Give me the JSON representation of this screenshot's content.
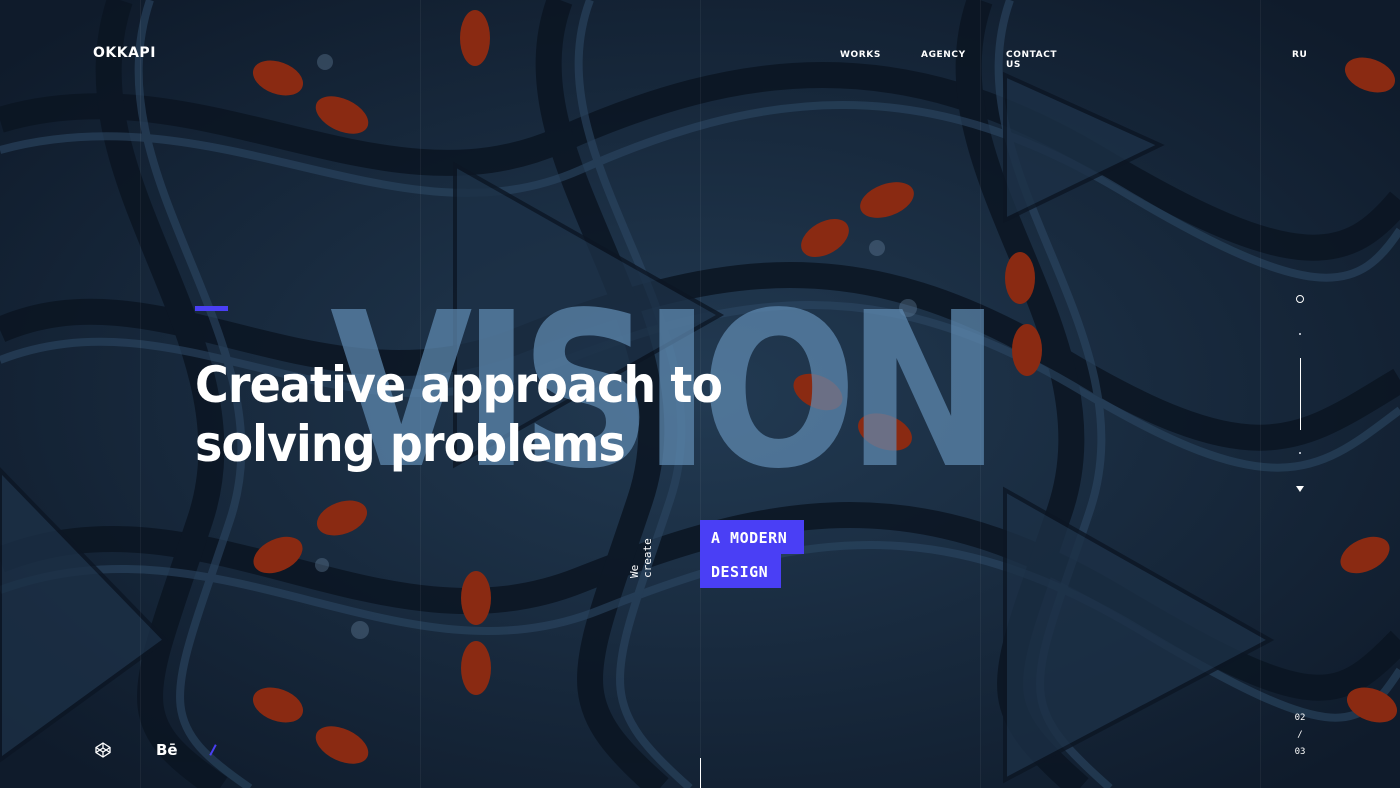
{
  "header": {
    "logo": "OKKAPI",
    "nav": [
      {
        "label": "WORKS"
      },
      {
        "label": "AGENCY"
      },
      {
        "label": "CONTACT US"
      }
    ],
    "lang": "RU"
  },
  "hero": {
    "background_word": "VISION",
    "headline_line1": "Creative approach to",
    "headline_line2": "solving problems",
    "sub_vertical_1": "We",
    "sub_vertical_2": "create",
    "tag_line1": "A MODERN",
    "tag_line2": "DESIGN"
  },
  "pager": {
    "current": "02",
    "separator": "/",
    "total": "03"
  },
  "social": [
    {
      "icon": "codepen-icon"
    },
    {
      "icon": "behance-icon",
      "label": "Bē"
    }
  ],
  "colors": {
    "accent": "#4a3ff5",
    "background": "#16263a",
    "big_word": "#608ab2",
    "decor_red": "#8a2a12"
  }
}
